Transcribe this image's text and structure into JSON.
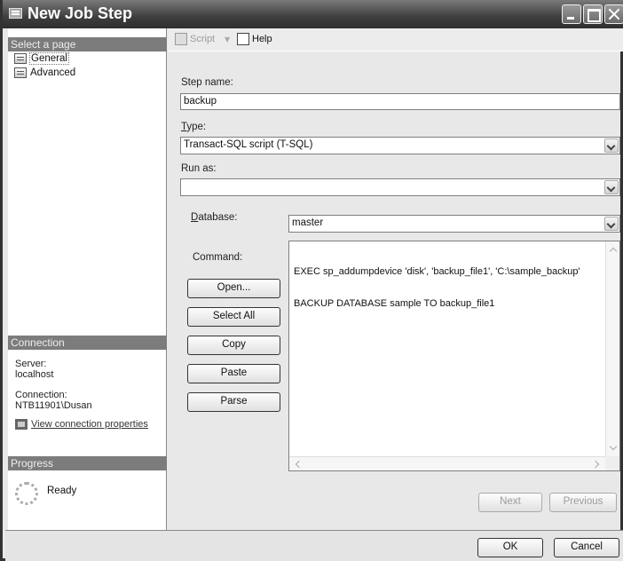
{
  "window": {
    "title": "New Job Step"
  },
  "left_pane": {
    "select_page_header": "Select a page",
    "pages": [
      {
        "label": "General",
        "icon": "page-settings-icon"
      },
      {
        "label": "Advanced",
        "icon": "page-settings-icon"
      }
    ],
    "connection_header": "Connection",
    "server_label": "Server:",
    "server_value": "localhost",
    "connection_label": "Connection:",
    "connection_value": "NTB11901\\Dusan",
    "view_connection_link": "View connection properties",
    "progress_header": "Progress",
    "progress_status": "Ready"
  },
  "toolbar": {
    "script_label": "Script",
    "help_label": "Help"
  },
  "form": {
    "step_name_label": "Step name:",
    "step_name_value": "backup",
    "type_label_pre": "",
    "type_label_accel": "T",
    "type_label_post": "ype:",
    "type_value": "Transact-SQL script (T-SQL)",
    "run_as_label": "Run as:",
    "run_as_value": "",
    "database_label_accel": "D",
    "database_label_post": "atabase:",
    "database_value": "master",
    "command_label": "Command:",
    "command_lines": [
      "EXEC sp_addumpdevice 'disk', 'backup_file1', 'C:\\sample_backup'",
      "BACKUP DATABASE sample TO backup_file1"
    ]
  },
  "command_buttons": {
    "open": "Open...",
    "select_all": "Select All",
    "copy": "Copy",
    "paste": "Paste",
    "parse": "Parse"
  },
  "nav_buttons": {
    "next": "Next",
    "previous": "Previous"
  },
  "dialog_buttons": {
    "ok": "OK",
    "cancel": "Cancel"
  }
}
